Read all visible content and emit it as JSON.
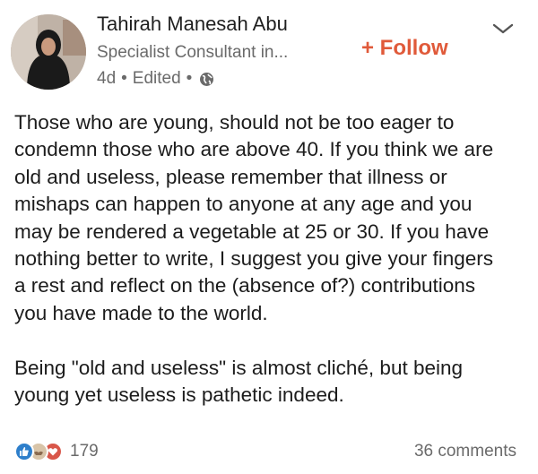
{
  "post": {
    "author_name": "Tahirah Manesah Abu",
    "author_headline": "Specialist Consultant in...",
    "time": "4d",
    "edited": "Edited",
    "meta_separator": "•",
    "visibility_icon": "globe-icon",
    "follow_label": "+ Follow",
    "menu_icon": "chevron-down-icon",
    "paragraphs": [
      "Those who are young, should not be too eager to\ncondemn those who are above 40. If you think we are\nold and useless, please remember that illness or\nmishaps can happen to anyone at any age and you\nmay be rendered a vegetable at 25 or 30. If you have\nnothing better to write, I suggest you give your fingers\na rest and reflect on the (absence of?) contributions\nyou have made to the world.",
      "Being \"old and useless\" is almost cliché, but being\nyoung yet useless is pathetic indeed."
    ]
  },
  "social": {
    "reaction_icons": [
      "like-icon",
      "support-icon",
      "love-icon"
    ],
    "reaction_count": "179",
    "comments_label": "36 comments"
  },
  "colors": {
    "follow": "#e05a3a",
    "secondary_text": "#6a6a6a",
    "like": "#2e7fcb",
    "love": "#d9574a"
  }
}
